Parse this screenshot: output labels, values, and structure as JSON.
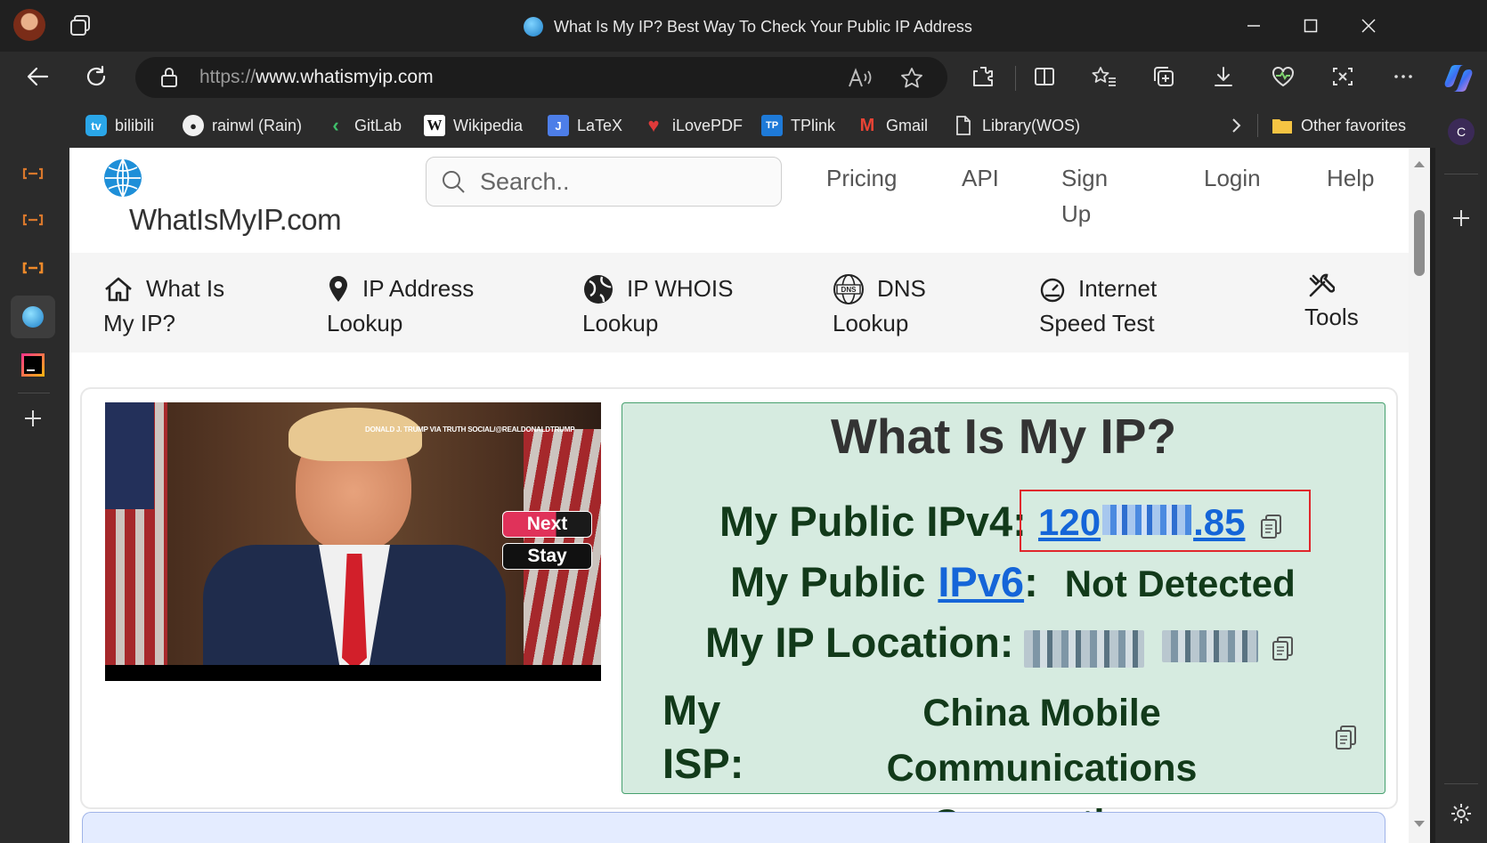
{
  "browser": {
    "tab_title": "What Is My IP? Best Way To Check Your Public IP Address",
    "url_scheme": "https://",
    "url_host": "www.whatismyip.com",
    "profile_initial": "C"
  },
  "favorites": [
    {
      "label": "bilibili"
    },
    {
      "label": "rainwl (Rain)"
    },
    {
      "label": "GitLab"
    },
    {
      "label": "Wikipedia"
    },
    {
      "label": "LaTeX"
    },
    {
      "label": "iLovePDF"
    },
    {
      "label": "TPlink"
    },
    {
      "label": "Gmail"
    },
    {
      "label": "Library(WOS)"
    }
  ],
  "favorites_folder": "Other favorites",
  "site": {
    "logo_text": "WhatIsMyIP.com",
    "search_placeholder": "Search..",
    "top_nav": {
      "pricing": "Pricing",
      "api": "API",
      "signup_line1": "Sign",
      "signup_line2": "Up",
      "login": "Login",
      "help": "Help"
    },
    "menu": [
      {
        "line1": "What Is",
        "line2": "My IP?"
      },
      {
        "line1": "IP Address",
        "line2": "Lookup"
      },
      {
        "line1": "IP WHOIS",
        "line2": "Lookup"
      },
      {
        "line1": "DNS",
        "line2": "Lookup"
      },
      {
        "line1": "Internet",
        "line2": "Speed Test"
      },
      {
        "line1": "",
        "line2": "Tools"
      }
    ]
  },
  "video": {
    "overlay_credit": "DONALD J. TRUMP VIA TRUTH SOCIAL/@REALDONALDTRUMP",
    "next_label": "Next",
    "stay_label": "Stay"
  },
  "ip": {
    "heading": "What Is My IP?",
    "ipv4_label": "My Public IPv4:",
    "ipv4_prefix": "120",
    "ipv4_suffix": ".85",
    "ipv6_label_a": "My Public",
    "ipv6_link": "IPv6",
    "ipv6_colon": ":",
    "ipv6_value": "Not Detected",
    "location_label": "My IP Location:",
    "isp_label_1": "My",
    "isp_label_2": "ISP:",
    "isp_line1": "China Mobile Communications",
    "isp_line2": "Corporation"
  }
}
